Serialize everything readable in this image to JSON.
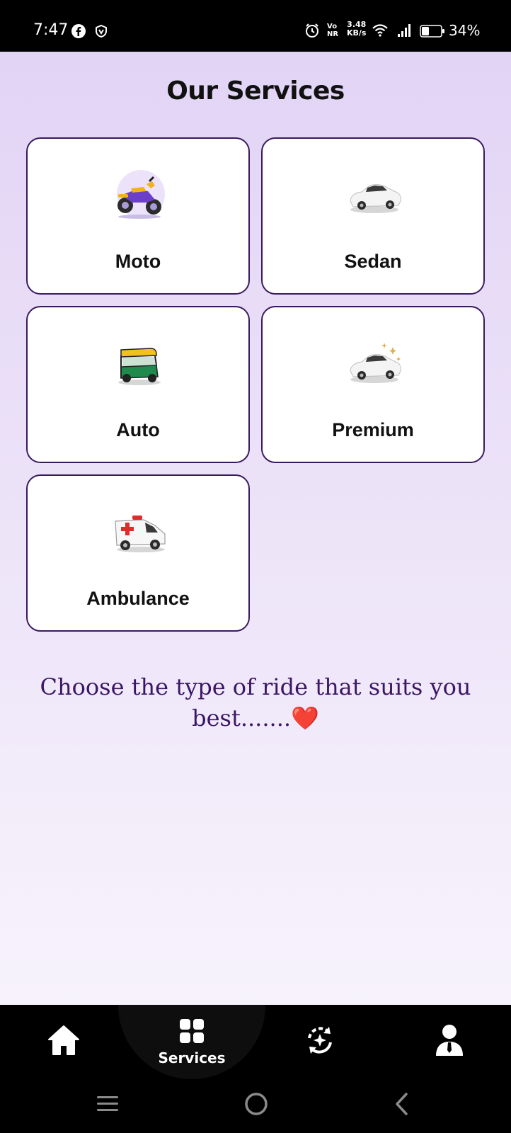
{
  "status_bar": {
    "time": "7:47",
    "net_speed_value": "3.48",
    "net_speed_unit": "KB/s",
    "volte_top": "Vo",
    "volte_bottom": "NR",
    "battery_percent": "34%",
    "icons": [
      "facebook-icon",
      "vpn-shield-icon",
      "alarm-icon",
      "wifi-icon",
      "signal-icon",
      "battery-icon"
    ]
  },
  "page": {
    "title": "Our Services",
    "tagline": "Choose the type of ride that suits you best.......",
    "tagline_emoji": "❤️"
  },
  "services": [
    {
      "label": "Moto",
      "icon": "motorcycle-icon"
    },
    {
      "label": "Sedan",
      "icon": "sedan-car-icon"
    },
    {
      "label": "Auto",
      "icon": "auto-rickshaw-icon"
    },
    {
      "label": "Premium",
      "icon": "premium-car-icon"
    },
    {
      "label": "Ambulance",
      "icon": "ambulance-icon"
    }
  ],
  "bottom_nav": {
    "active": "Services",
    "items": [
      {
        "name": "home",
        "icon": "home-icon",
        "label": ""
      },
      {
        "name": "services",
        "icon": "grid-icon",
        "label": "Services"
      },
      {
        "name": "activity",
        "icon": "refresh-sparkle-icon",
        "label": ""
      },
      {
        "name": "profile",
        "icon": "user-icon",
        "label": ""
      }
    ]
  },
  "colors": {
    "accent_purple": "#3b1763",
    "card_border": "#3a1a5e",
    "bg_top": "#e2d4f5",
    "bg_bottom": "#f7f3fc"
  }
}
